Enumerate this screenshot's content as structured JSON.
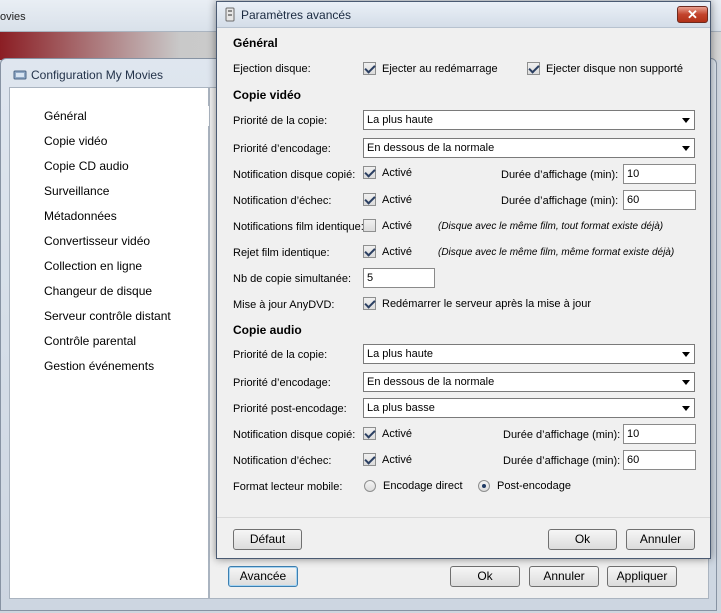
{
  "background_window": {
    "title_fragment": "ovies"
  },
  "config_window": {
    "title": "Configuration My Movies",
    "sidebar": [
      {
        "label": "Général"
      },
      {
        "label": "Copie vidéo"
      },
      {
        "label": "Copie CD audio"
      },
      {
        "label": "Surveillance"
      },
      {
        "label": "Métadonnées"
      },
      {
        "label": "Convertisseur vidéo"
      },
      {
        "label": "Collection en ligne"
      },
      {
        "label": "Changeur de disque"
      },
      {
        "label": "Serveur contrôle distant"
      },
      {
        "label": "Contrôle parental"
      },
      {
        "label": "Gestion événements"
      }
    ],
    "buttons": {
      "advanced": "Avancée",
      "ok": "Ok",
      "cancel": "Annuler",
      "apply": "Appliquer"
    }
  },
  "dialog": {
    "title": "Paramètres avancés",
    "close_label": "✕",
    "general": {
      "heading": "Général",
      "eject_label": "Ejection disque:",
      "eject_restart": {
        "label": "Ejecter au redémarrage",
        "checked": true
      },
      "eject_unsupported": {
        "label": "Ejecter disque non supporté",
        "checked": true
      }
    },
    "video": {
      "heading": "Copie vidéo",
      "copy_priority_label": "Priorité de la copie:",
      "copy_priority_value": "La plus haute",
      "encode_priority_label": "Priorité d’encodage:",
      "encode_priority_value": "En dessous de la normale",
      "notif_copied_label": "Notification disque copié:",
      "notif_copied_cb": "Activé",
      "notif_copied_duration_label": "Durée d’affichage (min):",
      "notif_copied_duration": "10",
      "notif_fail_label": "Notification d’échec:",
      "notif_fail_cb": "Activé",
      "notif_fail_duration_label": "Durée d’affichage (min):",
      "notif_fail_duration": "60",
      "notif_identical_label": "Notifications film identique:",
      "notif_identical_cb": "Activé",
      "notif_identical_note": "(Disque avec le même film, tout format existe déjà)",
      "reject_label": "Rejet film identique:",
      "reject_cb": "Activé",
      "reject_note": "(Disque avec le même film, même format existe déjà)",
      "simultaneous_label": "Nb de copie simultanée:",
      "simultaneous_value": "5",
      "anydvd_label": "Mise à jour AnyDVD:",
      "anydvd_cb": "Redémarrer le serveur après la mise à jour"
    },
    "audio": {
      "heading": "Copie audio",
      "copy_priority_label": "Priorité de la copie:",
      "copy_priority_value": "La plus haute",
      "encode_priority_label": "Priorité d’encodage:",
      "encode_priority_value": "En dessous de la normale",
      "post_priority_label": "Priorité post-encodage:",
      "post_priority_value": "La plus basse",
      "notif_copied_label": "Notification disque copié:",
      "notif_copied_cb": "Activé",
      "notif_copied_duration_label": "Durée d’affichage (min):",
      "notif_copied_duration": "10",
      "notif_fail_label": "Notification d’échec:",
      "notif_fail_cb": "Activé",
      "notif_fail_duration_label": "Durée d’affichage (min):",
      "notif_fail_duration": "60",
      "mobile_label": "Format lecteur mobile:",
      "mobile_direct": "Encodage direct",
      "mobile_post": "Post-encodage"
    },
    "buttons": {
      "default": "Défaut",
      "ok": "Ok",
      "cancel": "Annuler"
    }
  }
}
